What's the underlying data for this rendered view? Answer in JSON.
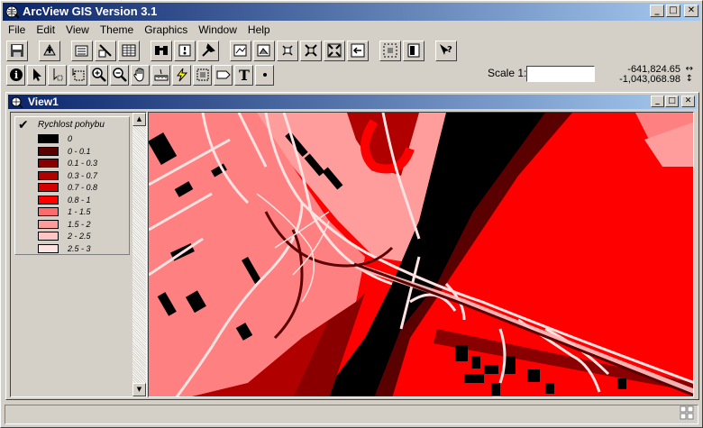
{
  "app": {
    "title": "ArcView GIS Version 3.1",
    "title_icon": "arcview-globe-icon"
  },
  "menu": {
    "items": [
      {
        "label": "File"
      },
      {
        "label": "Edit"
      },
      {
        "label": "View"
      },
      {
        "label": "Theme"
      },
      {
        "label": "Graphics"
      },
      {
        "label": "Window"
      },
      {
        "label": "Help"
      }
    ]
  },
  "toolbar_buttons": [
    "save-project-icon",
    "add-theme-icon",
    "theme-properties-icon",
    "edit-legend-icon",
    "open-table-icon",
    "find-icon",
    "locate-address-icon",
    "query-builder-icon",
    "zoom-to-full-extent-icon",
    "zoom-to-themes-icon",
    "zoom-to-selected-icon",
    "zoom-in-fixed-icon",
    "zoom-out-fixed-icon",
    "zoom-previous-icon",
    "select-features-icon",
    "layout-icon",
    "help-icon"
  ],
  "tools": [
    "identify-icon",
    "pointer-icon",
    "vertex-edit-icon",
    "select-feature-icon",
    "zoom-in-icon",
    "zoom-out-icon",
    "pan-icon",
    "measure-icon",
    "hotlink-icon",
    "area-of-interest-icon",
    "label-icon",
    "text-icon",
    "draw-point-icon"
  ],
  "scale": {
    "label": "Scale 1:",
    "value": ""
  },
  "coords": {
    "x": "-641,824.65",
    "y": "-1,043,068.98"
  },
  "view": {
    "title": "View1"
  },
  "legend": {
    "theme_name": "Rychlost pohybu",
    "visible": true,
    "classes": [
      {
        "label": "0",
        "color": "#000000"
      },
      {
        "label": "0 - 0.1",
        "color": "#5a0000"
      },
      {
        "label": "0.1 - 0.3",
        "color": "#8a0000"
      },
      {
        "label": "0.3 - 0.7",
        "color": "#b00000"
      },
      {
        "label": "0.7 - 0.8",
        "color": "#d60000"
      },
      {
        "label": "0.8 - 1",
        "color": "#ff0000"
      },
      {
        "label": "1 - 1.5",
        "color": "#ff6b6b"
      },
      {
        "label": "1.5 - 2",
        "color": "#ff9c9c"
      },
      {
        "label": "2 - 2.5",
        "color": "#ffc4c4"
      },
      {
        "label": "2.5 - 3",
        "color": "#ffe2e2"
      }
    ]
  },
  "status": {
    "text": ""
  }
}
